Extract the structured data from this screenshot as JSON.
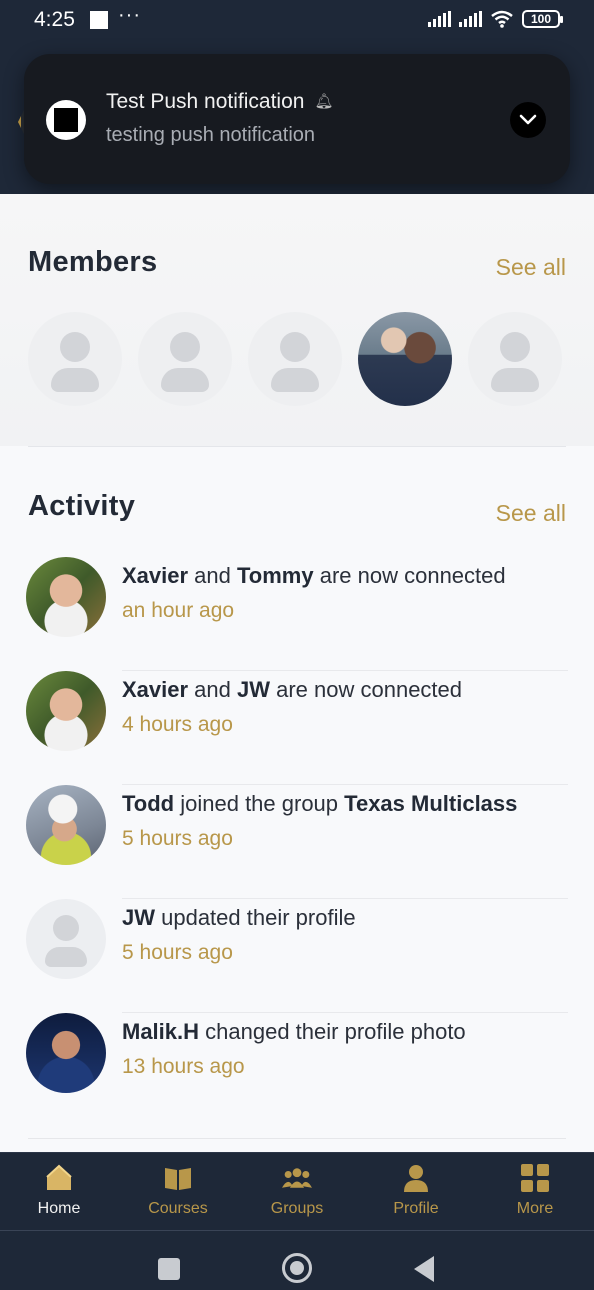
{
  "status_bar": {
    "time": "4:25",
    "dots": "···",
    "battery": "100"
  },
  "notification": {
    "title": "Test Push notification",
    "body": "testing push notification"
  },
  "members": {
    "title": "Members",
    "see_all": "See all"
  },
  "activity": {
    "title": "Activity",
    "see_all": "See all",
    "items": [
      {
        "actor": "Xavier",
        "mid": " and ",
        "target": "Tommy",
        "rest": " are now connected",
        "time": "an hour ago"
      },
      {
        "actor": "Xavier",
        "mid": " and ",
        "target": "JW",
        "rest": " are now connected",
        "time": "4 hours ago"
      },
      {
        "actor": "Todd",
        "mid": " joined the group ",
        "target": "Texas Multiclass",
        "rest": "",
        "time": "5 hours ago"
      },
      {
        "actor": "JW",
        "mid": " updated their profile",
        "target": "",
        "rest": "",
        "time": "5 hours ago"
      },
      {
        "actor": "Malik.H",
        "mid": " changed their profile photo",
        "target": "",
        "rest": "",
        "time": "13 hours ago"
      }
    ]
  },
  "tabbar": {
    "home": "Home",
    "courses": "Courses",
    "groups": "Groups",
    "profile": "Profile",
    "more": "More"
  },
  "colors": {
    "accent_gold": "#b8974a",
    "header_navy": "#1e2838"
  }
}
